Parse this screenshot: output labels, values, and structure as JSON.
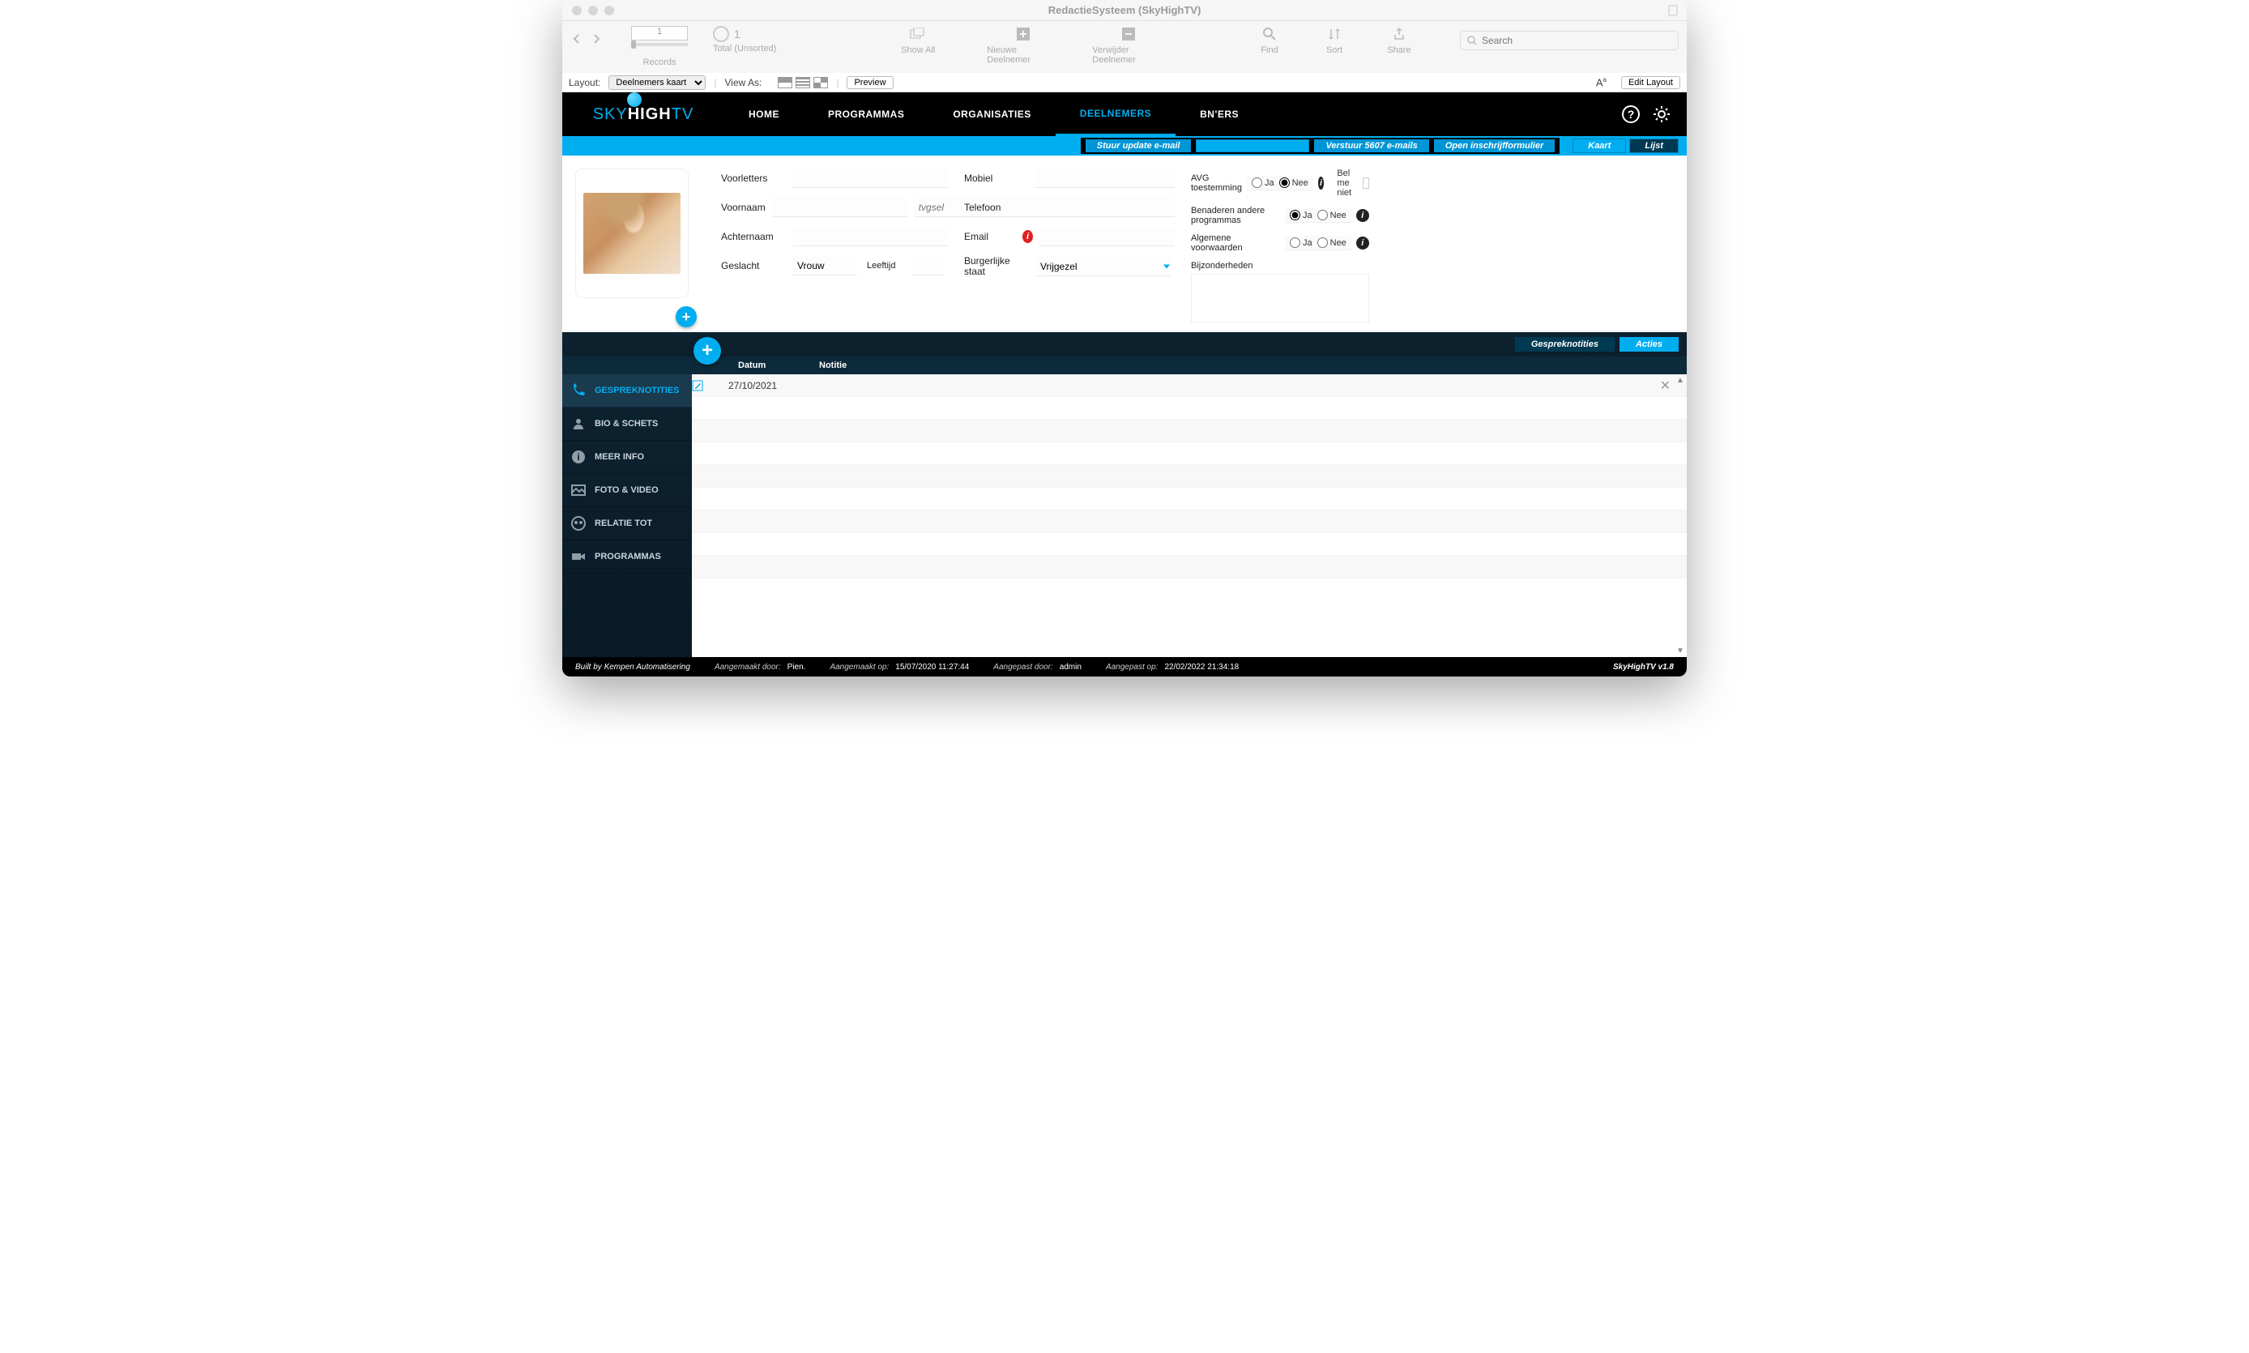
{
  "window": {
    "title": "RedactieSysteem (SkyHighTV)"
  },
  "fm_toolbar": {
    "record_number": "1",
    "record_total": "1",
    "total_label": "Total (Unsorted)",
    "records_label": "Records",
    "show_all": "Show All",
    "new_record": "Nieuwe Deelnemer",
    "delete_record": "Verwijder Deelnemer",
    "find": "Find",
    "sort": "Sort",
    "share": "Share",
    "search_placeholder": "Search"
  },
  "layout_bar": {
    "layout_label": "Layout:",
    "layout_value": "Deelnemers kaart",
    "view_as": "View As:",
    "preview": "Preview",
    "edit_layout": "Edit Layout"
  },
  "nav": {
    "items": [
      "HOME",
      "PROGRAMMAS",
      "ORGANISATIES",
      "DEELNEMERS",
      "BN'ERS"
    ],
    "active_index": 3
  },
  "action_bar": {
    "send_update": "Stuur  update e-mail",
    "send_bulk": "Verstuur 5607 e-mails",
    "open_form": "Open inschrijfformulier",
    "kaart": "Kaart",
    "lijst": "Lijst"
  },
  "form": {
    "labels": {
      "voorletters": "Voorletters",
      "voornaam": "Voornaam",
      "achternaam": "Achternaam",
      "geslacht": "Geslacht",
      "leeftijd": "Leeftijd",
      "mobiel": "Mobiel",
      "telefoon": "Telefoon",
      "email": "Email",
      "burgerlijke": "Burgerlijke staat",
      "avg": "AVG toestemming",
      "benaderen": "Benaderen andere programmas",
      "algemene": "Algemene voorwaarden",
      "bijzonder": "Bijzonderheden",
      "belme": "Bel me niet"
    },
    "values": {
      "voornaam_placeholder": "tvgsel",
      "geslacht": "Vrouw",
      "burgerlijke": "Vrijgezel"
    },
    "radio": {
      "ja": "Ja",
      "nee": "Nee"
    },
    "avg_selected": "Nee",
    "benaderen_selected": "Ja"
  },
  "section_tabs": {
    "gesprek": "Gespreknotities",
    "acties": "Acties"
  },
  "sidebar": {
    "items": [
      {
        "id": "gesprek",
        "label": "GESPREKNOTITIES"
      },
      {
        "id": "bio",
        "label": "BIO & SCHETS"
      },
      {
        "id": "meer",
        "label": "MEER INFO"
      },
      {
        "id": "foto",
        "label": "FOTO & VIDEO"
      },
      {
        "id": "relatie",
        "label": "RELATIE TOT"
      },
      {
        "id": "prog",
        "label": "PROGRAMMAS"
      }
    ],
    "active_index": 0
  },
  "notes_table": {
    "headers": {
      "datum": "Datum",
      "notitie": "Notitie"
    },
    "rows": [
      {
        "date": "27/10/2021",
        "note": ""
      }
    ]
  },
  "footer": {
    "built": "Built by Kempen Automatisering",
    "created_by_lbl": "Aangemaakt door:",
    "created_by": "Pien.",
    "created_on_lbl": "Aangemaakt op:",
    "created_on": "15/07/2020 11:27:44",
    "modified_by_lbl": "Aangepast door:",
    "modified_by": "admin",
    "modified_on_lbl": "Aangepast op:",
    "modified_on": "22/02/2022 21:34:18",
    "version": "SkyHighTV v1.8"
  }
}
